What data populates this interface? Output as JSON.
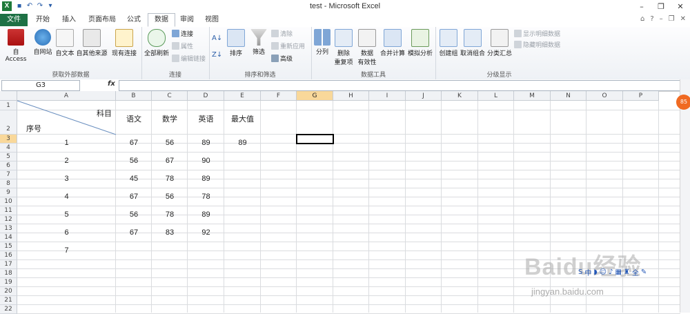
{
  "window": {
    "title": "test - Microsoft Excel",
    "min": "–",
    "restore": "❐",
    "close": "✕"
  },
  "tabs": [
    "文件",
    "开始",
    "插入",
    "页面布局",
    "公式",
    "数据",
    "审阅",
    "视图"
  ],
  "tabs_active": "数据",
  "ribbon": {
    "get_external": {
      "label": "获取外部数据",
      "access": "自 Access",
      "web": "自网站",
      "text": "自文本",
      "other": "自其他来源",
      "existing": "现有连接"
    },
    "connections": {
      "label": "连接",
      "refresh_all": "全部刷新",
      "connections": "连接",
      "properties": "属性",
      "edit_links": "编辑链接"
    },
    "sort_filter": {
      "label": "排序和筛选",
      "sort": "排序",
      "filter": "筛选",
      "clear": "清除",
      "reapply": "重新应用",
      "advanced": "高级"
    },
    "data_tools": {
      "label": "数据工具",
      "text_to_columns": "分列",
      "remove_dup_1": "删除",
      "remove_dup_2": "重复项",
      "validation_1": "数据",
      "validation_2": "有效性",
      "consolidate": "合并计算",
      "what_if": "模拟分析"
    },
    "outline": {
      "label": "分级显示",
      "group": "创建组",
      "ungroup": "取消组合",
      "subtotal": "分类汇总",
      "show_detail": "显示明细数据",
      "hide_detail": "隐藏明细数据"
    }
  },
  "formula_bar": {
    "name_box": "G3",
    "fx": "fx",
    "content": ""
  },
  "columns": [
    "A",
    "B",
    "C",
    "D",
    "E",
    "F",
    "G",
    "H",
    "I",
    "J",
    "K",
    "L",
    "M",
    "N",
    "O",
    "P"
  ],
  "selected_column": "G",
  "rows": [
    "1",
    "2",
    "3",
    "4",
    "5",
    "6",
    "7",
    "8",
    "9",
    "10",
    "11",
    "12",
    "13",
    "14",
    "15",
    "16",
    "17",
    "18",
    "19",
    "20",
    "21",
    "22"
  ],
  "selected_row": "3",
  "table": {
    "header_subject": "科目",
    "header_id": "序号",
    "subjects": [
      "语文",
      "数学",
      "英语",
      "最大值"
    ],
    "rows": [
      {
        "id": "1",
        "c": "67",
        "m": "56",
        "e": "89",
        "max": "89"
      },
      {
        "id": "2",
        "c": "56",
        "m": "67",
        "e": "90",
        "max": ""
      },
      {
        "id": "3",
        "c": "45",
        "m": "78",
        "e": "89",
        "max": ""
      },
      {
        "id": "4",
        "c": "67",
        "m": "56",
        "e": "78",
        "max": ""
      },
      {
        "id": "5",
        "c": "56",
        "m": "78",
        "e": "89",
        "max": ""
      },
      {
        "id": "6",
        "c": "67",
        "m": "83",
        "e": "92",
        "max": ""
      },
      {
        "id": "7",
        "c": "",
        "m": "",
        "e": "",
        "max": ""
      }
    ]
  },
  "badge": "85",
  "watermark": {
    "main": "Baidu经验",
    "sub": "jingyan.baidu.com"
  },
  "colors": {
    "file_tab": "#1e7145",
    "selection": "#f9d89a",
    "badge": "#f06a22"
  }
}
